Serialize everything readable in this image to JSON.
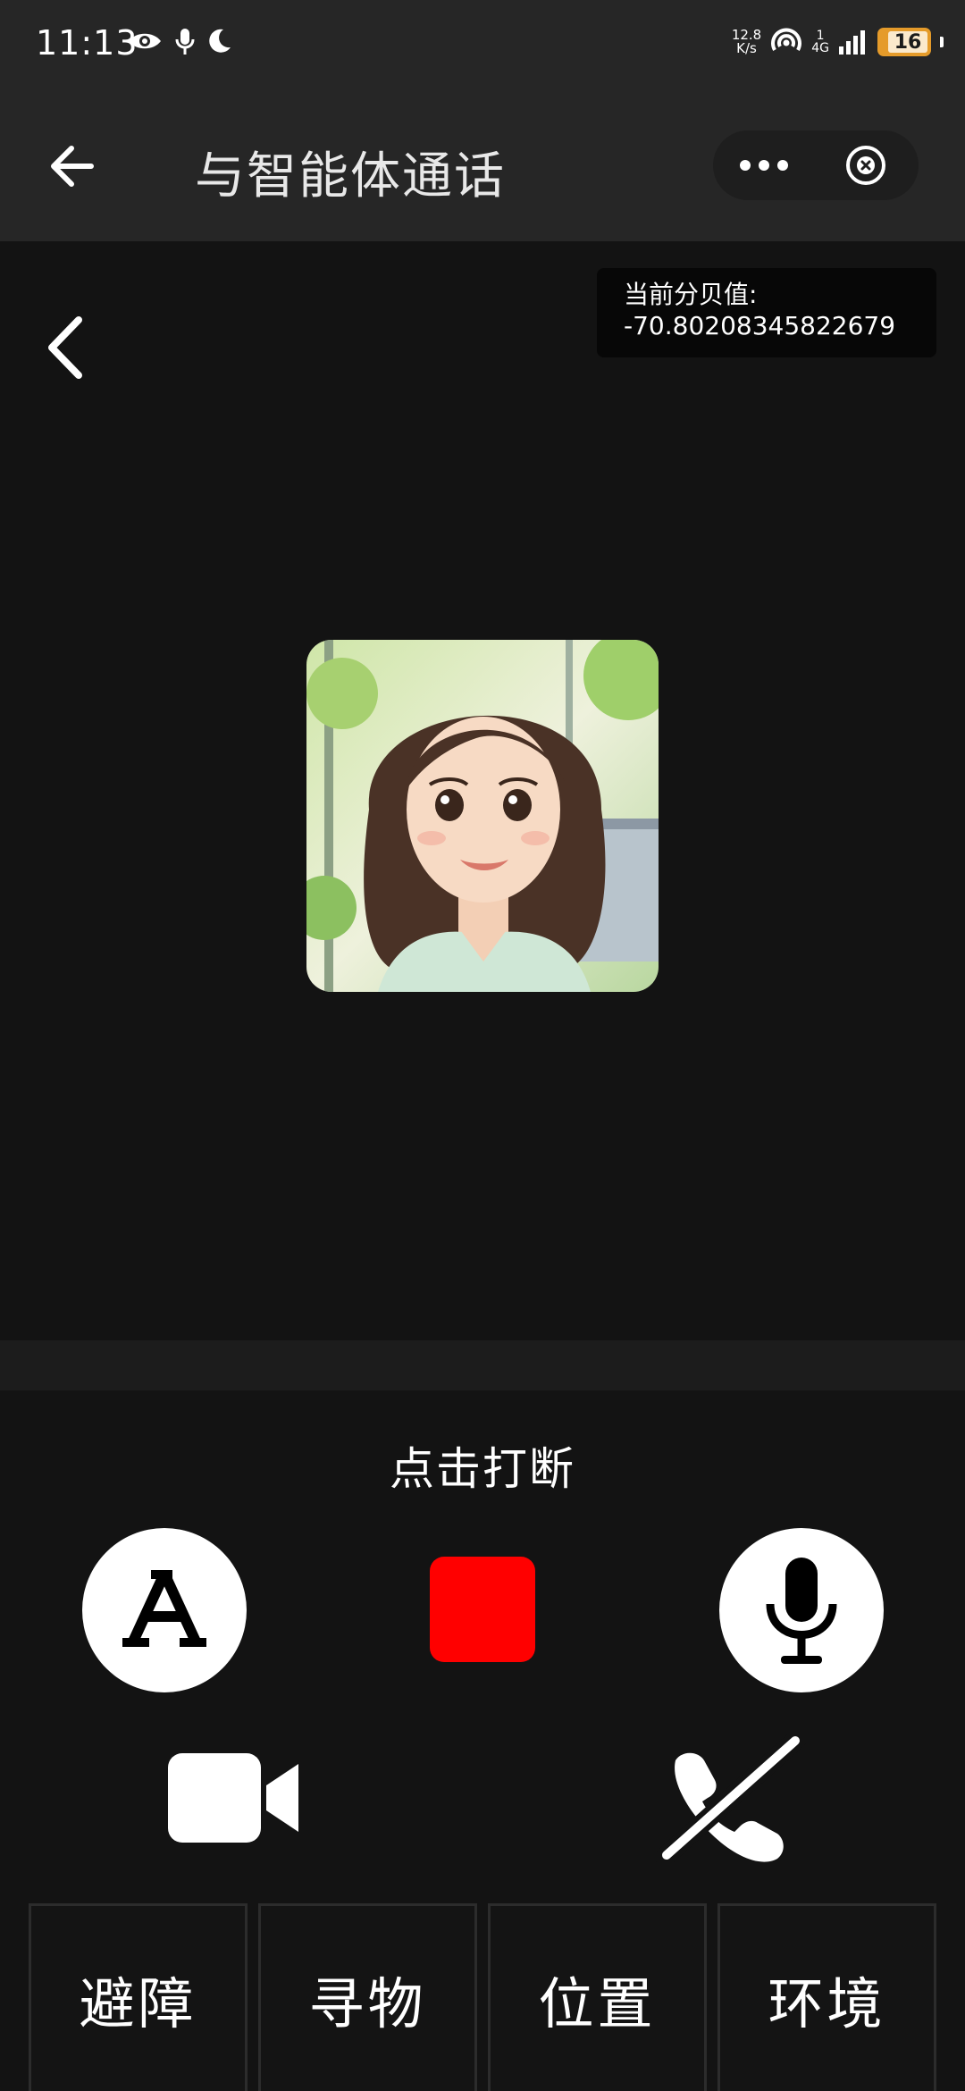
{
  "status_bar": {
    "time": "11:13",
    "net_speed_value": "12.8",
    "net_speed_unit": "K/s",
    "network_type": "4G",
    "signal_sim": "1",
    "battery_level": "16",
    "icons": [
      "eye-icon",
      "mic-icon",
      "moon-icon",
      "hotspot-icon",
      "signal-icon",
      "battery-icon"
    ]
  },
  "header": {
    "title": "与智能体通话",
    "icons": [
      "back-arrow-icon",
      "more-icon",
      "close-icon"
    ]
  },
  "decibel": {
    "label": "当前分贝值:",
    "value": "-70.80208345822679"
  },
  "controls": {
    "interrupt_label": "点击打断",
    "font_button_glyph": "A",
    "stop_color": "#ff0000",
    "icons": [
      "font-icon",
      "stop-icon",
      "mic-icon",
      "video-camera-icon",
      "hang-up-icon"
    ]
  },
  "tabs": [
    {
      "label": "避障"
    },
    {
      "label": "寻物"
    },
    {
      "label": "位置"
    },
    {
      "label": "环境"
    }
  ],
  "colors": {
    "background": "#131313",
    "header_bg": "#262626",
    "battery": "#e59b2a",
    "stop_button": "#ff0000"
  }
}
